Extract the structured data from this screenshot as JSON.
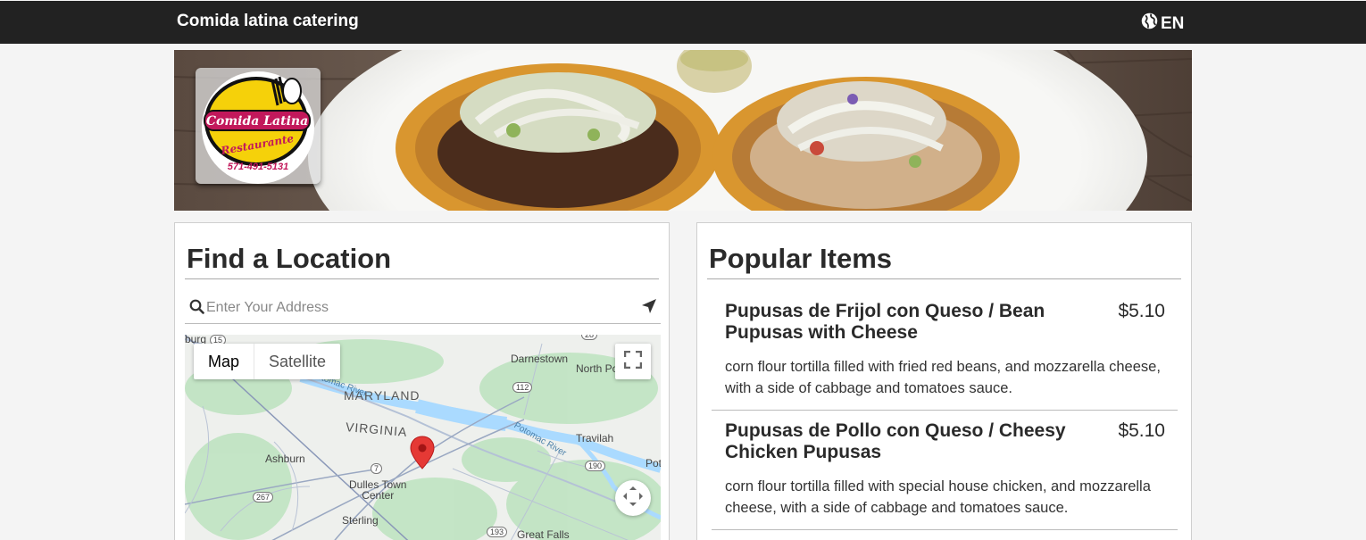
{
  "header": {
    "brand": "Comida latina catering",
    "language": "EN"
  },
  "hero": {
    "logo_title": "Comida Latina",
    "logo_subtitle": "Restaurante",
    "logo_phone": "571-491-5131"
  },
  "location": {
    "title": "Find a Location",
    "search_placeholder": "Enter Your Address",
    "map_type_options": [
      "Map",
      "Satellite"
    ],
    "map_type_selected": "Map",
    "map_labels": {
      "maryland": "MARYLAND",
      "virginia": "VIRGINIA",
      "potomac1": "Potomac River",
      "potomac2": "Potomac River",
      "darnestown": "Darnestown",
      "north_potomac": "North Po",
      "travilah": "Travilah",
      "potomac_town": "Pot",
      "ashburn": "Ashburn",
      "dulles": "Dulles Town\nCenter",
      "sterling": "Sterling",
      "great_falls": "Great Falls",
      "burg": "burg",
      "r112": "112",
      "r7": "7",
      "r267": "267",
      "r190": "190",
      "r193": "193",
      "r28": "28",
      "r15": "15"
    }
  },
  "popular": {
    "title": "Popular Items",
    "items": [
      {
        "name": "Pupusas de Frijol con Queso / Bean Pupusas with Cheese",
        "price": "$5.10",
        "description": "corn flour tortilla filled with fried red beans, and mozzarella cheese, with a side of cabbage and tomatoes sauce."
      },
      {
        "name": "Pupusas de Pollo con Queso / Cheesy Chicken Pupusas",
        "price": "$5.10",
        "description": "corn flour tortilla filled with special house chicken, and mozzarella cheese, with a side of cabbage and tomatoes sauce."
      }
    ]
  },
  "colors": {
    "topbar": "#222222",
    "marker": "#e53935",
    "water": "#aadaff",
    "logo_yellow": "#f5d10a",
    "logo_red": "#c2185b"
  }
}
